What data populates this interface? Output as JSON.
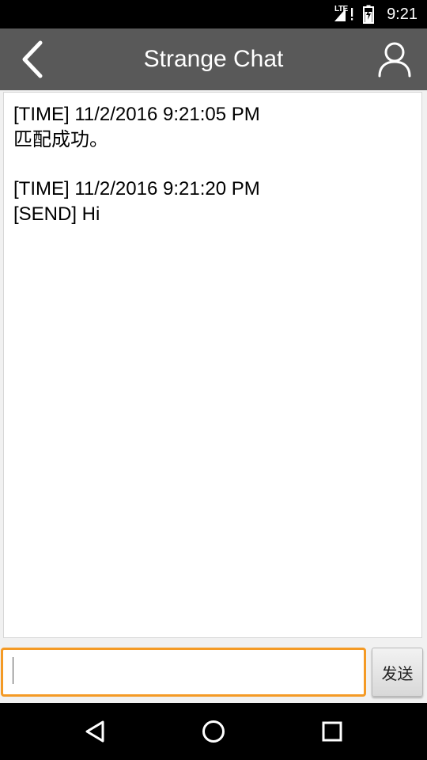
{
  "status_bar": {
    "network": "LTE",
    "time": "9:21",
    "icons": [
      "lte-signal-icon",
      "alert-icon",
      "battery-charging-icon"
    ]
  },
  "app_bar": {
    "title": "Strange Chat",
    "back_icon": "chevron-left-icon",
    "profile_icon": "user-icon"
  },
  "chat": {
    "messages": [
      {
        "time_line": "[TIME] 11/2/2016 9:21:05 PM",
        "text_line": "匹配成功。"
      },
      {
        "time_line": "[TIME] 11/2/2016 9:21:20 PM",
        "text_line": "[SEND] Hi"
      }
    ]
  },
  "composer": {
    "value": "",
    "placeholder": "",
    "send_label": "发送"
  },
  "nav_bar": {
    "icons": [
      "back-triangle-icon",
      "home-circle-icon",
      "recents-square-icon"
    ]
  },
  "colors": {
    "status_bar": "#000000",
    "app_bar": "#595959",
    "input_focus_border": "#f49a25",
    "background": "#f1f1f1"
  }
}
